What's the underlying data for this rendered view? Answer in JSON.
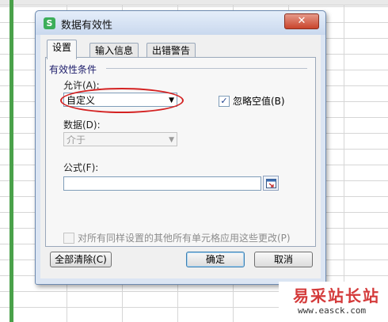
{
  "dialog": {
    "title": "数据有效性",
    "app_icon_letter": "S",
    "close_symbol": "✕",
    "tabs": [
      {
        "label": "设置"
      },
      {
        "label": "输入信息"
      },
      {
        "label": "出错警告"
      }
    ],
    "settings": {
      "group_title": "有效性条件",
      "allow_label": "允许(A):",
      "allow_value": "自定义",
      "ignore_blank_label": "忽略空值(B)",
      "ignore_blank_checked": true,
      "data_label": "数据(D):",
      "data_value": "介于",
      "formula_label": "公式(F):",
      "formula_value": "",
      "apply_all_label": "对所有同样设置的其他所有单元格应用这些更改(P)",
      "apply_all_checked": false
    },
    "buttons": {
      "clear_all": "全部清除(C)",
      "ok": "确定",
      "cancel": "取消"
    },
    "highlight_color": "#d42222"
  },
  "watermark": {
    "text": "易采站长站",
    "url": "www.easck.com"
  },
  "icons": {
    "dropdown": "chevron-down-icon",
    "checkmark": "check-icon",
    "range_select": "range-select-icon"
  }
}
